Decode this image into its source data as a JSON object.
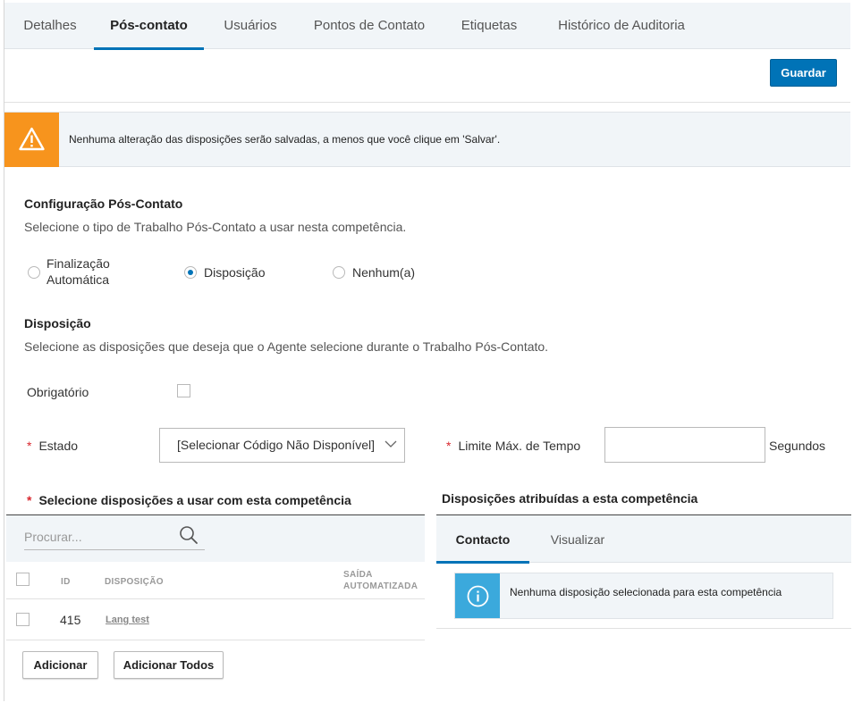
{
  "tabs": [
    {
      "label": "Detalhes"
    },
    {
      "label": "Pós-contato"
    },
    {
      "label": "Usuários"
    },
    {
      "label": "Pontos de Contato"
    },
    {
      "label": "Etiquetas"
    },
    {
      "label": "Histórico de Auditoria"
    }
  ],
  "active_tab": "Pós-contato",
  "save_label": "Guardar",
  "warning": {
    "icon": "warning-triangle-icon",
    "text": "Nenhuma alteração das disposições serão salvadas, a menos que você clique em 'Salvar'."
  },
  "post_contact": {
    "title": "Configuração Pós-Contato",
    "description": "Selecione o tipo de Trabalho Pós-Contato a usar nesta competência.",
    "options": [
      {
        "line1": "Finalização",
        "line2": "Automática",
        "checked": false
      },
      {
        "label": "Disposição",
        "checked": true
      },
      {
        "label": "Nenhum(a)",
        "checked": false
      }
    ]
  },
  "disposition": {
    "title": "Disposição",
    "description": "Selecione as disposições que deseja que o Agente selecione durante o Trabalho Pós-Contato.",
    "required_label": "Obrigatório",
    "required_checked": false,
    "state_label": "Estado",
    "state_value": "[Selecionar Código Não Disponível]",
    "max_time_label": "Limite Máx. de Tempo",
    "max_time_value": "",
    "seconds_label": "Segundos",
    "required_marker": "*"
  },
  "select_panel": {
    "title": "Selecione disposições a usar com esta competência",
    "search_placeholder": "Procurar...",
    "columns": {
      "id": "ID",
      "disposition": "DISPOSIÇÃO",
      "auto_exit_line1": "SAÍDA",
      "auto_exit_line2": "AUTOMATIZADA"
    },
    "rows": [
      {
        "id": "415",
        "name": "Lang test",
        "checked": false
      }
    ],
    "add_label": "Adicionar",
    "add_all_label": "Adicionar Todos"
  },
  "assigned_panel": {
    "title": "Disposições atribuídas a esta competência",
    "tabs": [
      {
        "label": "Contacto"
      },
      {
        "label": "Visualizar"
      }
    ],
    "active_tab": "Contacto",
    "empty_message": "Nenhuma disposição selecionada para esta competência"
  },
  "colors": {
    "primary": "#0073b7",
    "warning": "#f7941d",
    "info": "#3ba9dc",
    "required": "#d9272e",
    "panel_bg": "#f1f5f8"
  }
}
